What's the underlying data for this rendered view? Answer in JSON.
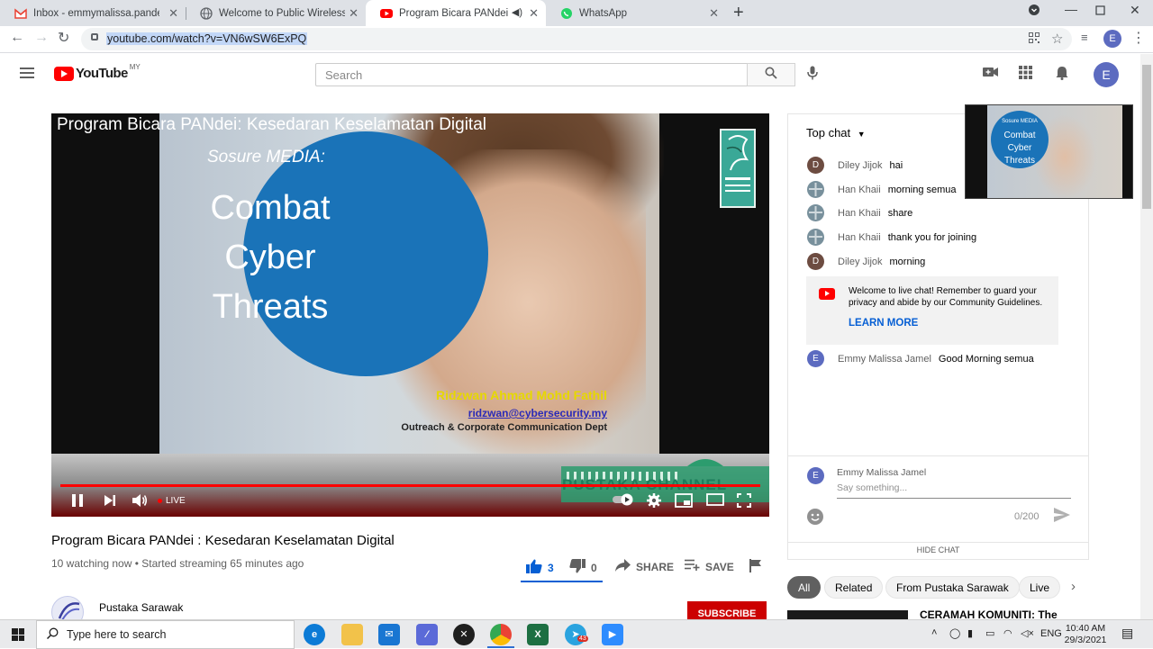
{
  "browser": {
    "tabs": [
      {
        "title": "Inbox - emmymalissa.pandei@gm",
        "icon": "gmail-icon"
      },
      {
        "title": "Welcome to Public Wireless Netw",
        "icon": "globe-icon"
      },
      {
        "title": "Program Bicara PANdei : Kes",
        "icon": "youtube-icon",
        "active": true
      },
      {
        "title": "WhatsApp",
        "icon": "whatsapp-icon"
      }
    ],
    "new_tab": "+",
    "url": "youtube.com/watch?v=VN6wSW6ExPQ",
    "profile_initial": "E"
  },
  "youtube": {
    "logo_text": "YouTube",
    "country_code": "MY",
    "search_placeholder": "Search",
    "avatar_initial": "E"
  },
  "video": {
    "overlay_title": "Program Bicara PANdei: Kesedaran Keselamatan Digital",
    "slide_subtitle": "Sosure MEDIA:",
    "slide_lines": [
      "Combat",
      "Cyber",
      "Threats"
    ],
    "presenter_name": "Ridzwan Ahmad Mohd Fathil",
    "presenter_email": "ridzwan@cybersecurity.my",
    "presenter_dept": "Outreach & Corporate Communication Dept",
    "channel_watermark": "PUSTAKA CHANNEL",
    "live_label": "LIVE",
    "title": "Program Bicara PANdei : Kesedaran Keselamatan Digital",
    "meta": "10 watching now • Started streaming 65 minutes ago",
    "likes": "3",
    "dislikes": "0",
    "share_label": "SHARE",
    "save_label": "SAVE",
    "channel_name": "Pustaka Sarawak",
    "subscribe_label": "SUBSCRIBE"
  },
  "chat": {
    "header": "Top chat",
    "messages": [
      {
        "author": "Diley Jijok",
        "text": "hai",
        "initial": "D",
        "color": "#6d4c41"
      },
      {
        "author": "Han Khaii",
        "text": "morning semua",
        "initial": "",
        "color": "#78909c"
      },
      {
        "author": "Han Khaii",
        "text": "share",
        "initial": "",
        "color": "#78909c"
      },
      {
        "author": "Han Khaii",
        "text": "thank you for joining",
        "initial": "",
        "color": "#78909c"
      },
      {
        "author": "Diley Jijok",
        "text": "morning",
        "initial": "D",
        "color": "#6d4c41"
      }
    ],
    "welcome_text": "Welcome to live chat! Remember to guard your privacy and abide by our Community Guidelines.",
    "learn_more": "LEARN MORE",
    "after_message": {
      "author": "Emmy Malissa Jamel",
      "text": "Good Morning semua",
      "initial": "E",
      "color": "#5c6bc0"
    },
    "input_author": "Emmy Malissa Jamel",
    "input_placeholder": "Say something...",
    "counter": "0/200",
    "hide_chat": "HIDE CHAT",
    "mini_player_lines": [
      "Sosure MEDIA",
      "Combat",
      "Cyber",
      "Threats"
    ]
  },
  "related": {
    "chips": [
      "All",
      "Related",
      "From Pustaka Sarawak",
      "Live"
    ],
    "first_title": "CERAMAH KOMUNITI: The"
  },
  "taskbar": {
    "search_placeholder": "Type here to search",
    "lang": "ENG",
    "time": "10:40 AM",
    "date": "29/3/2021",
    "telegram_badge": "43"
  },
  "colors": {
    "accent": "#065fd4",
    "youtube_red": "#ff0000",
    "slide_blue": "#1a73b8"
  }
}
